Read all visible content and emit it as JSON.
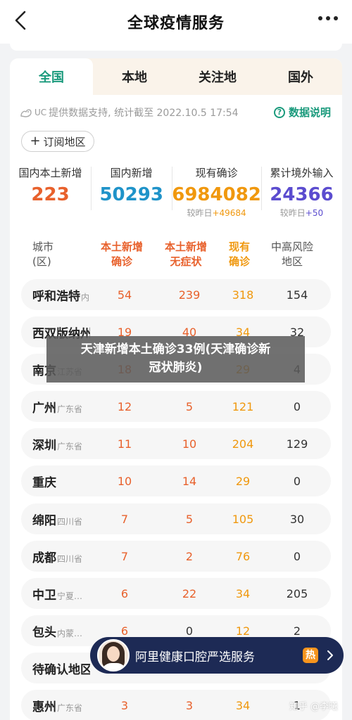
{
  "header": {
    "title": "全球疫情服务"
  },
  "tabs": [
    {
      "label": "全国",
      "active": true
    },
    {
      "label": "本地",
      "active": false
    },
    {
      "label": "关注地",
      "active": false
    },
    {
      "label": "国外",
      "active": false
    }
  ],
  "source": {
    "brand": "UC",
    "text": "提供数据支持, 统计截至 2022.10.5 17:54"
  },
  "explain_label": "数据说明",
  "subscribe_label": "订阅地区",
  "stats": [
    {
      "label": "国内本土新增",
      "value": "223",
      "delta": "",
      "color": "#e8612c"
    },
    {
      "label": "国内新增",
      "value": "50293",
      "delta": "",
      "color": "#1f93c9"
    },
    {
      "label": "现有确诊",
      "value": "6984082",
      "delta_prefix": "较昨日",
      "delta": "+49684",
      "color": "#f0980e"
    },
    {
      "label": "累计境外输入",
      "value": "24366",
      "delta_prefix": "较昨日",
      "delta": "+50",
      "color": "#5b4ccf"
    }
  ],
  "table": {
    "headers": {
      "city": [
        "城市",
        "(区)"
      ],
      "local_new": [
        "本土新增",
        "确诊"
      ],
      "asymptomatic": [
        "本土新增",
        "无症状"
      ],
      "existing": [
        "现有",
        "确诊"
      ],
      "risk": [
        "中高风险",
        "地区"
      ]
    },
    "rows": [
      {
        "city": "呼和浩特",
        "province": "内蒙...",
        "local_new": "54",
        "asymptomatic": "239",
        "existing": "318",
        "risk": "154"
      },
      {
        "city": "西双版纳州",
        "province": "云...",
        "local_new": "19",
        "asymptomatic": "40",
        "existing": "34",
        "risk": "32"
      },
      {
        "city": "南京",
        "province": "江苏省",
        "local_new": "18",
        "asymptomatic": "",
        "existing": "29",
        "risk": "4"
      },
      {
        "city": "广州",
        "province": "广东省",
        "local_new": "12",
        "asymptomatic": "5",
        "existing": "121",
        "risk": "0"
      },
      {
        "city": "深圳",
        "province": "广东省",
        "local_new": "11",
        "asymptomatic": "10",
        "existing": "204",
        "risk": "129"
      },
      {
        "city": "重庆",
        "province": "",
        "local_new": "10",
        "asymptomatic": "14",
        "existing": "29",
        "risk": "0"
      },
      {
        "city": "绵阳",
        "province": "四川省",
        "local_new": "7",
        "asymptomatic": "5",
        "existing": "105",
        "risk": "30"
      },
      {
        "city": "成都",
        "province": "四川省",
        "local_new": "7",
        "asymptomatic": "2",
        "existing": "76",
        "risk": "0"
      },
      {
        "city": "中卫",
        "province": "宁夏回族自...",
        "local_new": "6",
        "asymptomatic": "22",
        "existing": "34",
        "risk": "205"
      },
      {
        "city": "包头",
        "province": "内蒙古自治区",
        "local_new": "6",
        "asymptomatic": "0",
        "existing": "12",
        "risk": "2"
      },
      {
        "city": "待确认地区",
        "province": "",
        "local_new": "",
        "asymptomatic": "",
        "existing": "",
        "risk": ""
      },
      {
        "city": "惠州",
        "province": "广东省",
        "local_new": "3",
        "asymptomatic": "3",
        "existing": "34",
        "risk": "1"
      }
    ]
  },
  "overlay": {
    "line1": "天津新增本土确诊33例(天津确诊新",
    "line2": "冠状肺炎)"
  },
  "ad": {
    "text": "阿里健康口腔严选服务",
    "badge": "热"
  },
  "watermark": "知乎 @李曦"
}
